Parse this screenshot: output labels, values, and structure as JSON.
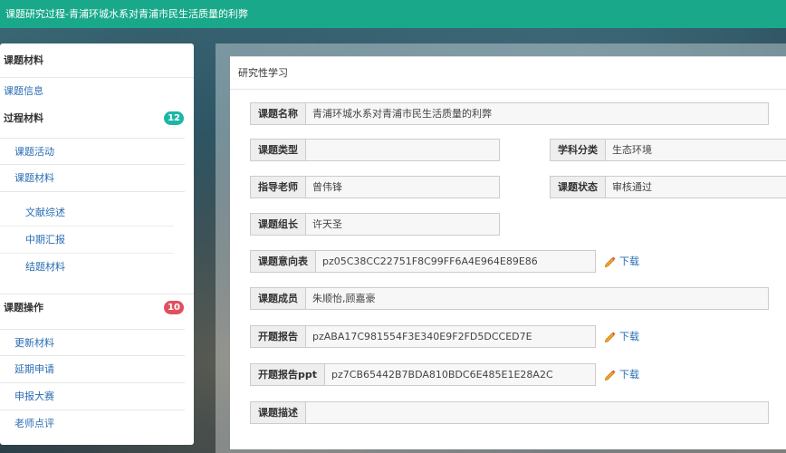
{
  "header": {
    "title": "课题研究过程-青浦环城水系对青浦市民生活质量的利弊"
  },
  "sidebar": {
    "section_materials": "课题材料",
    "topic_info": "课题信息",
    "process_materials": {
      "label": "过程材料",
      "badge": "12"
    },
    "process_items": [
      "课题活动",
      "课题材料"
    ],
    "sub_items": [
      "文献综述",
      "中期汇报",
      "结题材料"
    ],
    "operations": {
      "label": "课题操作",
      "badge": "10"
    },
    "operation_items": [
      "更新材料",
      "延期申请",
      "申报大赛",
      "老师点评"
    ]
  },
  "panel": {
    "title": "研究性学习",
    "fields": {
      "topic_name": {
        "label": "课题名称",
        "value": "青浦环城水系对青浦市民生活质量的利弊"
      },
      "topic_type": {
        "label": "课题类型",
        "value": ""
      },
      "subject_category": {
        "label": "学科分类",
        "value": "生态环境"
      },
      "advisor": {
        "label": "指导老师",
        "value": "曾伟锋"
      },
      "topic_status": {
        "label": "课题状态",
        "value": "审核通过"
      },
      "leader": {
        "label": "课题组长",
        "value": "许天圣"
      },
      "intent_form": {
        "label": "课题意向表",
        "value": "pz05C38CC22751F8C99FF6A4E964E89E86"
      },
      "members": {
        "label": "课题成员",
        "value": "朱顺怡,顾嘉豪"
      },
      "opening_report": {
        "label": "开题报告",
        "value": "pzABA17C981554F3E340E9F2FD5DCCED7E"
      },
      "opening_report_ppt": {
        "label": "开题报告ppt",
        "value": "pz7CB65442B7BDA810BDC6E485E1E28A2C"
      },
      "description": {
        "label": "课题描述",
        "value": ""
      }
    },
    "download_label": "下载"
  },
  "colors": {
    "topbar": "#19a98a",
    "link": "#2a6db3",
    "badge_teal": "#1bb7a6",
    "badge_red": "#e0505e"
  }
}
